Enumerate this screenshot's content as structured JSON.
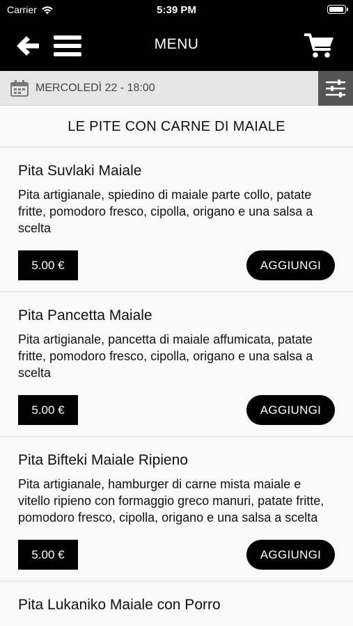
{
  "status_bar": {
    "carrier": "Carrier",
    "time": "5:39 PM"
  },
  "nav": {
    "title": "MENU"
  },
  "date_bar": {
    "text": "MERCOLEDÌ 22 - 18:00"
  },
  "section": {
    "title": "LE PITE CON CARNE DI MAIALE"
  },
  "items": [
    {
      "name": "Pita Suvlaki Maiale",
      "description": "Pita artigianale, spiedino di maiale parte collo, patate fritte, pomodoro fresco, cipolla, origano e una salsa a scelta",
      "price": "5.00 €",
      "add_label": "AGGIUNGI"
    },
    {
      "name": "Pita Pancetta Maiale",
      "description": "Pita artigianale, pancetta di maiale affumicata, patate fritte, pomodoro fresco, cipolla, origano e una salsa a scelta",
      "price": "5.00 €",
      "add_label": "AGGIUNGI"
    },
    {
      "name": "Pita Bifteki Maiale Ripieno",
      "description": "Pita artigianale, hamburger di carne mista maiale e vitello ripieno con formaggio greco manuri, patate fritte, pomodoro fresco, cipolla, origano e una salsa a scelta",
      "price": "5.00 €",
      "add_label": "AGGIUNGI"
    },
    {
      "name": "Pita Lukaniko Maiale con Porro",
      "description": "",
      "price": "",
      "add_label": ""
    }
  ],
  "icons": {
    "back": "arrow-left-icon",
    "menu": "hamburger-icon",
    "cart": "cart-icon",
    "calendar": "calendar-icon",
    "filter": "sliders-icon",
    "wifi": "wifi-icon",
    "battery": "battery-icon"
  }
}
